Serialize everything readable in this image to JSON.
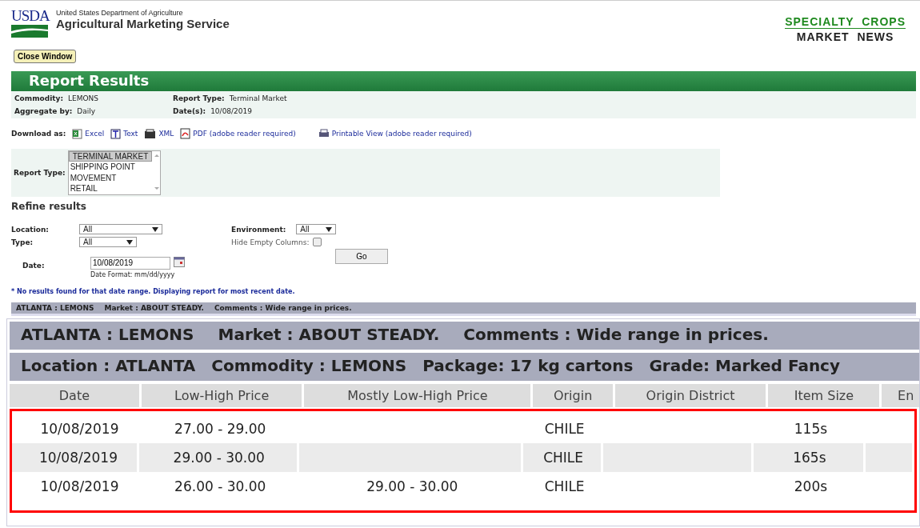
{
  "header": {
    "agency_line": "United States Department of Agriculture",
    "agency_name": "Agricultural Marketing Service",
    "logo_text": "USDA",
    "program_top": "SPECIALTY  CROPS",
    "program_bottom": "MARKET  NEWS"
  },
  "close_button": "Close Window",
  "report_title": "Report Results",
  "summary": [
    {
      "label": "Commodity:",
      "value": "LEMONS"
    },
    {
      "label": "Report Type:",
      "value": "Terminal Market"
    },
    {
      "label": "Aggregate by:",
      "value": "Daily"
    },
    {
      "label": "Date(s):",
      "value": "10/08/2019"
    }
  ],
  "download": {
    "label": "Download as:",
    "links": [
      {
        "kind": "excel",
        "text": "Excel"
      },
      {
        "kind": "text",
        "text": "Text"
      },
      {
        "kind": "xml",
        "text": "XML"
      },
      {
        "kind": "pdf",
        "text": "PDF (adobe reader required)"
      },
      {
        "kind": "print",
        "text": "Printable View (adobe reader required)"
      }
    ]
  },
  "report_type": {
    "label": "Report Type:",
    "options": [
      {
        "text": "TERMINAL MARKET",
        "selected": true
      },
      {
        "text": "SHIPPING POINT",
        "selected": false
      },
      {
        "text": "MOVEMENT",
        "selected": false
      },
      {
        "text": "RETAIL",
        "selected": false
      }
    ]
  },
  "refine": {
    "title": "Refine results",
    "location": {
      "label": "Location:",
      "value": "All"
    },
    "type": {
      "label": "Type:",
      "value": "All"
    },
    "date": {
      "label": "Date:",
      "value": "10/08/2019",
      "hint": "Date Format: mm/dd/yyyy"
    },
    "environment": {
      "label": "Environment:",
      "value": "All"
    },
    "hide_empty": {
      "label": "Hide Empty Columns:",
      "checked": false
    },
    "go_button": "Go"
  },
  "notice": "* No results found for that date range. Displaying report for most recent date.",
  "market_bar": [
    "ATLANTA : LEMONS",
    "Market : ABOUT STEADY.",
    "Comments : Wide range in prices."
  ],
  "inset": {
    "market_line": [
      "ATLANTA : LEMONS",
      "Market : ABOUT STEADY.",
      "Comments : Wide range in prices."
    ],
    "location_line": [
      "Location : ATLANTA",
      "Commodity : LEMONS",
      "Package: 17 kg cartons",
      "Grade: Marked Fancy"
    ],
    "columns": [
      "Date",
      "Low-High Price",
      "Mostly Low-High Price",
      "Origin",
      "Origin District",
      "Item Size",
      "En"
    ],
    "rows": [
      [
        "10/08/2019",
        "27.00 - 29.00",
        "",
        "CHILE",
        "",
        "115s",
        ""
      ],
      [
        "10/08/2019",
        "29.00 - 30.00",
        "",
        "CHILE",
        "",
        "165s",
        ""
      ],
      [
        "10/08/2019",
        "26.00 - 30.00",
        "29.00 - 30.00",
        "CHILE",
        "",
        "200s",
        ""
      ]
    ]
  }
}
